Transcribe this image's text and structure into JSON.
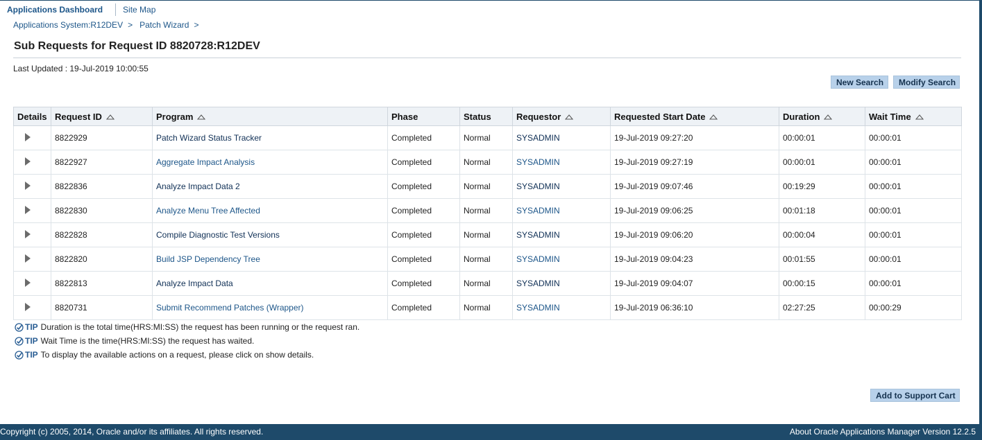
{
  "global_nav": {
    "dashboard": "Applications Dashboard",
    "site_map": "Site Map"
  },
  "breadcrumb": {
    "items": [
      "Applications System:R12DEV",
      "Patch Wizard"
    ],
    "separator": ">"
  },
  "page": {
    "title": "Sub Requests for Request ID 8820728:R12DEV",
    "last_updated": "Last Updated : 19-Jul-2019 10:00:55"
  },
  "buttons": {
    "new_search": "New Search",
    "modify_search": "Modify Search",
    "add_to_cart": "Add to Support Cart"
  },
  "table": {
    "headers": {
      "details": "Details",
      "request_id": "Request ID",
      "program": "Program",
      "phase": "Phase",
      "status": "Status",
      "requestor": "Requestor",
      "start_date": "Requested Start Date",
      "duration": "Duration",
      "wait_time": "Wait Time"
    },
    "rows": [
      {
        "request_id": "8822929",
        "program": "Patch Wizard Status Tracker",
        "phase": "Completed",
        "status": "Normal",
        "requestor": "SYSADMIN",
        "start_date": "19-Jul-2019 09:27:20",
        "duration": "00:00:01",
        "wait_time": "00:00:01"
      },
      {
        "request_id": "8822927",
        "program": "Aggregate Impact Analysis",
        "phase": "Completed",
        "status": "Normal",
        "requestor": "SYSADMIN",
        "start_date": "19-Jul-2019 09:27:19",
        "duration": "00:00:01",
        "wait_time": "00:00:01"
      },
      {
        "request_id": "8822836",
        "program": "Analyze Impact Data 2",
        "phase": "Completed",
        "status": "Normal",
        "requestor": "SYSADMIN",
        "start_date": "19-Jul-2019 09:07:46",
        "duration": "00:19:29",
        "wait_time": "00:00:01"
      },
      {
        "request_id": "8822830",
        "program": "Analyze Menu Tree Affected",
        "phase": "Completed",
        "status": "Normal",
        "requestor": "SYSADMIN",
        "start_date": "19-Jul-2019 09:06:25",
        "duration": "00:01:18",
        "wait_time": "00:00:01"
      },
      {
        "request_id": "8822828",
        "program": "Compile Diagnostic Test Versions",
        "phase": "Completed",
        "status": "Normal",
        "requestor": "SYSADMIN",
        "start_date": "19-Jul-2019 09:06:20",
        "duration": "00:00:04",
        "wait_time": "00:00:01"
      },
      {
        "request_id": "8822820",
        "program": "Build JSP Dependency Tree",
        "phase": "Completed",
        "status": "Normal",
        "requestor": "SYSADMIN",
        "start_date": "19-Jul-2019 09:04:23",
        "duration": "00:01:55",
        "wait_time": "00:00:01"
      },
      {
        "request_id": "8822813",
        "program": "Analyze Impact Data",
        "phase": "Completed",
        "status": "Normal",
        "requestor": "SYSADMIN",
        "start_date": "19-Jul-2019 09:04:07",
        "duration": "00:00:15",
        "wait_time": "00:00:01"
      },
      {
        "request_id": "8820731",
        "program": "Submit Recommend Patches (Wrapper)",
        "phase": "Completed",
        "status": "Normal",
        "requestor": "SYSADMIN",
        "start_date": "19-Jul-2019 06:36:10",
        "duration": "02:27:25",
        "wait_time": "00:00:29"
      }
    ]
  },
  "tips": {
    "label": "TIP",
    "items": [
      "Duration is the total time(HRS:MI:SS) the request has been running or the request ran.",
      "Wait Time is the time(HRS:MI:SS) the request has waited.",
      "To display the available actions on a request, please click on show details."
    ]
  },
  "footer": {
    "copyright": "Copyright (c) 2005, 2014, Oracle and/or its affiliates. All rights reserved.",
    "about": "About Oracle Applications Manager Version 12.2.5"
  },
  "colors": {
    "brand_dark": "#1e4a6a",
    "link": "#1d5689",
    "button_bg": "#b8d1ea",
    "header_bg": "#eef2f6"
  }
}
